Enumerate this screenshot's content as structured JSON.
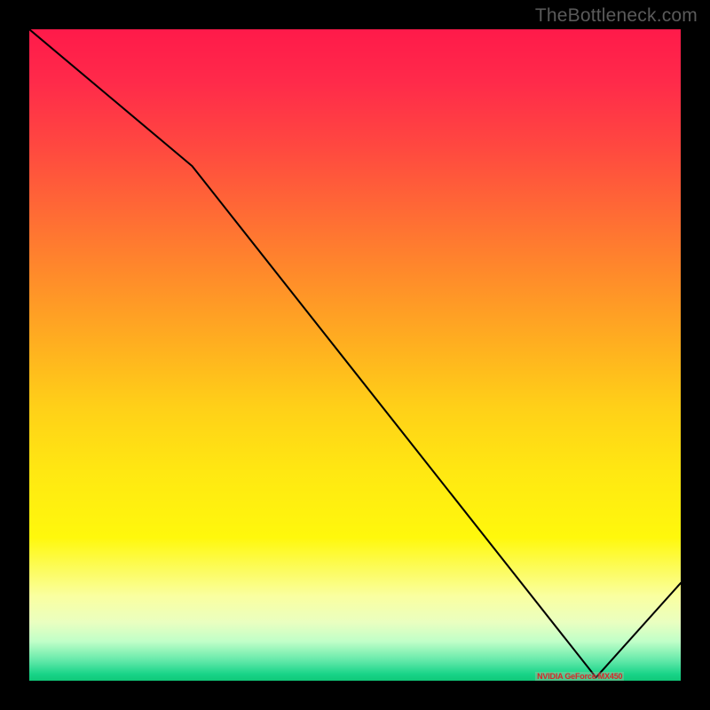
{
  "attribution": "TheBottleneck.com",
  "bottom_label_text": "NVIDIA GeForce MX450",
  "bottom_label_left_pct": 84.5,
  "chart_data": {
    "type": "line",
    "title": "",
    "xlabel": "",
    "ylabel": "",
    "x": [
      0,
      25,
      87,
      100
    ],
    "values": [
      100,
      79,
      0.5,
      15
    ],
    "ylim": [
      0,
      100
    ],
    "xlim": [
      0,
      100
    ],
    "annotations": [
      {
        "text": "NVIDIA GeForce MX450",
        "x": 84.5,
        "y": 0.5
      }
    ],
    "notes": "Background vertical gradient red→yellow→green indicating desirability; black curve shows bottleneck metric vs. x-axis variable; minimum marked with red label near x≈84."
  }
}
